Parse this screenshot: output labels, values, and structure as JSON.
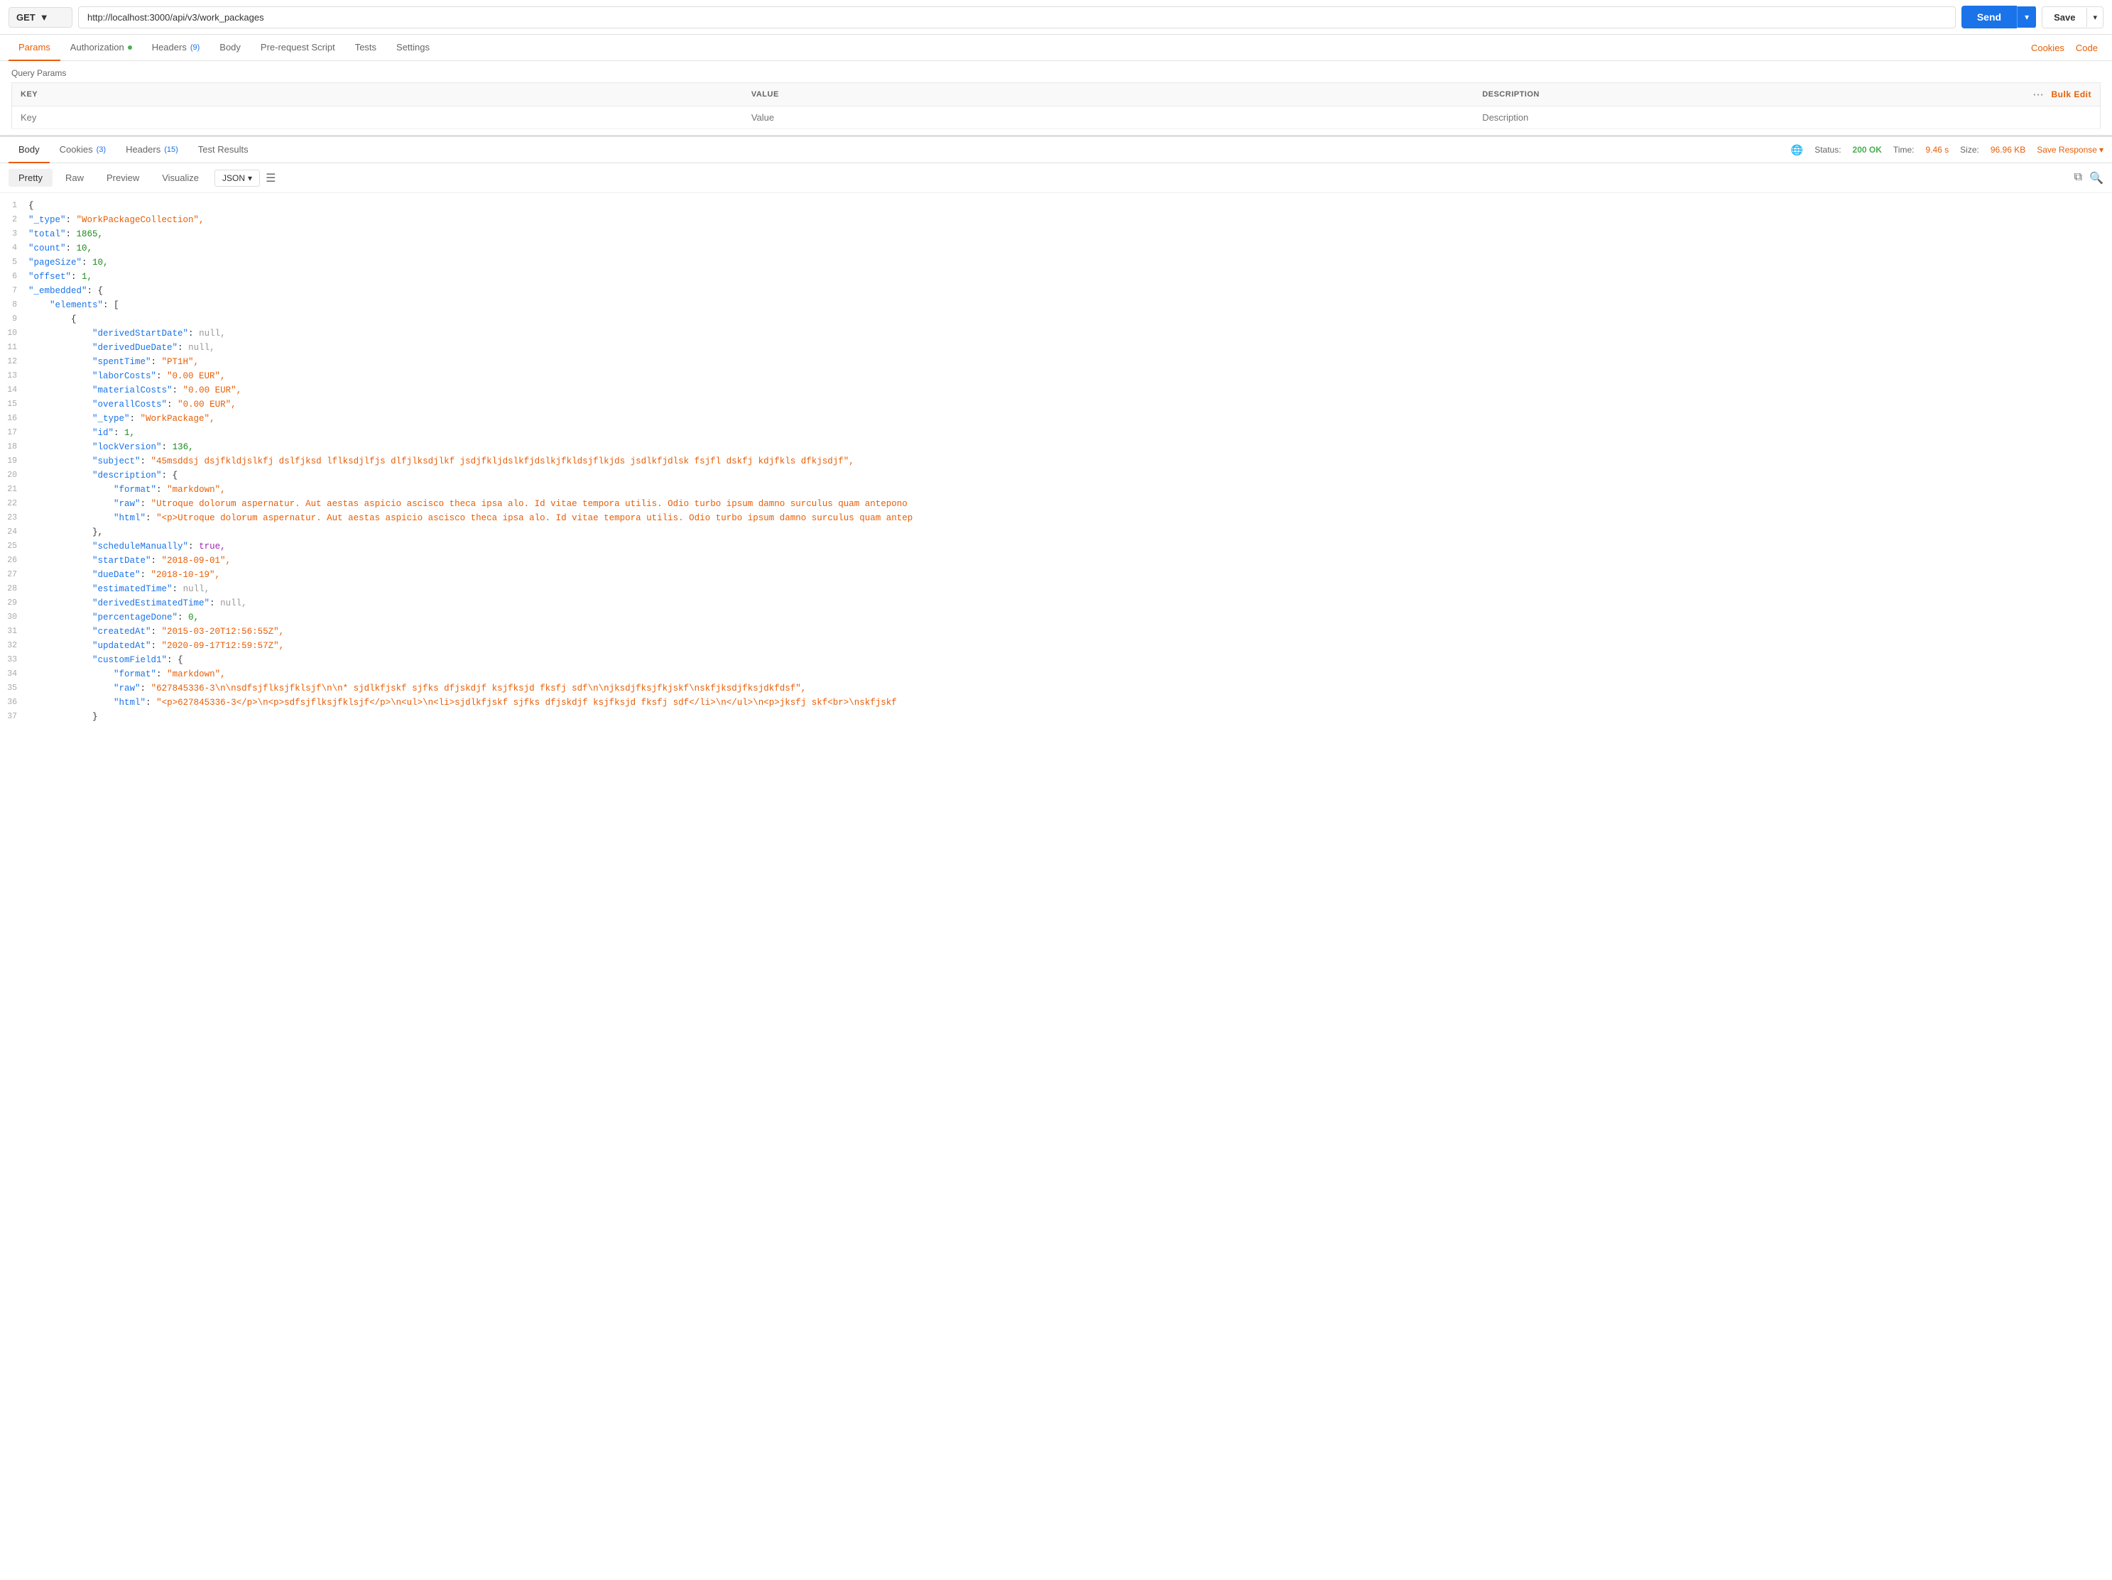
{
  "request_bar": {
    "method": "GET",
    "method_dropdown_icon": "▼",
    "url": "http://localhost:3000/api/v3/work_packages",
    "send_label": "Send",
    "send_dropdown_icon": "▾",
    "save_label": "Save",
    "save_dropdown_icon": "▾"
  },
  "request_tabs": [
    {
      "id": "params",
      "label": "Params",
      "active": true
    },
    {
      "id": "authorization",
      "label": "Authorization",
      "has_dot": true
    },
    {
      "id": "headers",
      "label": "Headers",
      "badge": "(9)"
    },
    {
      "id": "body",
      "label": "Body"
    },
    {
      "id": "prerequest",
      "label": "Pre-request Script"
    },
    {
      "id": "tests",
      "label": "Tests"
    },
    {
      "id": "settings",
      "label": "Settings"
    }
  ],
  "tab_links": [
    {
      "id": "cookies",
      "label": "Cookies"
    },
    {
      "id": "code",
      "label": "Code"
    }
  ],
  "query_params": {
    "title": "Query Params",
    "columns": [
      "KEY",
      "VALUE",
      "DESCRIPTION"
    ],
    "placeholder_row": {
      "key": "Key",
      "value": "Value",
      "description": "Description"
    }
  },
  "response": {
    "tabs": [
      {
        "id": "body",
        "label": "Body",
        "active": true
      },
      {
        "id": "cookies",
        "label": "Cookies",
        "badge": "(3)"
      },
      {
        "id": "headers",
        "label": "Headers",
        "badge": "(15)"
      },
      {
        "id": "test_results",
        "label": "Test Results"
      }
    ],
    "status_label": "Status:",
    "status_value": "200 OK",
    "time_label": "Time:",
    "time_value": "9.46 s",
    "size_label": "Size:",
    "size_value": "96.96 KB",
    "save_response_label": "Save Response",
    "save_response_icon": "▾"
  },
  "body_controls": {
    "view_tabs": [
      {
        "id": "pretty",
        "label": "Pretty",
        "active": true
      },
      {
        "id": "raw",
        "label": "Raw"
      },
      {
        "id": "preview",
        "label": "Preview"
      },
      {
        "id": "visualize",
        "label": "Visualize"
      }
    ],
    "format": "JSON",
    "format_icon": "▾"
  },
  "code_lines": [
    {
      "num": 1,
      "content": "{",
      "type": "plain"
    },
    {
      "num": 2,
      "content": "\"_type\": \"WorkPackageCollection\",",
      "key": "_type",
      "value": "WorkPackageCollection"
    },
    {
      "num": 3,
      "content": "\"total\": 1865,",
      "key": "total",
      "value": "1865"
    },
    {
      "num": 4,
      "content": "\"count\": 10,",
      "key": "count",
      "value": "10"
    },
    {
      "num": 5,
      "content": "\"pageSize\": 10,",
      "key": "pageSize",
      "value": "10"
    },
    {
      "num": 6,
      "content": "\"offset\": 1,",
      "key": "offset",
      "value": "1"
    },
    {
      "num": 7,
      "content": "\"_embedded\": {",
      "key": "_embedded"
    },
    {
      "num": 8,
      "content": "    \"elements\": [",
      "key": "elements"
    },
    {
      "num": 9,
      "content": "        {",
      "type": "plain"
    },
    {
      "num": 10,
      "content": "            \"derivedStartDate\": null,",
      "key": "derivedStartDate",
      "value": "null"
    },
    {
      "num": 11,
      "content": "            \"derivedDueDate\": null,",
      "key": "derivedDueDate",
      "value": "null"
    },
    {
      "num": 12,
      "content": "            \"spentTime\": \"PT1H\",",
      "key": "spentTime",
      "value": "PT1H"
    },
    {
      "num": 13,
      "content": "            \"laborCosts\": \"0.00 EUR\",",
      "key": "laborCosts",
      "value": "0.00 EUR"
    },
    {
      "num": 14,
      "content": "            \"materialCosts\": \"0.00 EUR\",",
      "key": "materialCosts",
      "value": "0.00 EUR"
    },
    {
      "num": 15,
      "content": "            \"overallCosts\": \"0.00 EUR\",",
      "key": "overallCosts",
      "value": "0.00 EUR"
    },
    {
      "num": 16,
      "content": "            \"_type\": \"WorkPackage\",",
      "key": "_type",
      "value": "WorkPackage"
    },
    {
      "num": 17,
      "content": "            \"id\": 1,",
      "key": "id",
      "value": "1"
    },
    {
      "num": 18,
      "content": "            \"lockVersion\": 136,",
      "key": "lockVersion",
      "value": "136"
    },
    {
      "num": 19,
      "content": "            \"subject\": \"45msddsj dsjfkldjslkfj dslfjksd lflksdjlfjs dlfjlksdjlkf jsdjfkljdslkfjdslkjfkldsjflkjds jsdlkfjdlsk fsjfl dskfj kdjfkls dfkjsdjf\",",
      "key": "subject",
      "value": "45msddsj dsjfkldjslkfj dslfjksd lflksdjlfjs dlfjlksdjlkf jsdjfkljdslkfjdslkjfkldsjflkjds jsdlkfjdlsk fsjfl dskfj kdjfkls dfkjsdjf"
    },
    {
      "num": 20,
      "content": "            \"description\": {",
      "key": "description"
    },
    {
      "num": 21,
      "content": "                \"format\": \"markdown\",",
      "key": "format",
      "value": "markdown"
    },
    {
      "num": 22,
      "content": "                \"raw\": \"Utroque dolorum aspernatur. Aut aestas aspicio ascisco theca ipsa alo. Id vitae tempora utilis. Odio turbo ipsum damno surculus quam antepono",
      "key": "raw",
      "value": "Utroque dolorum aspernatur. Aut aestas aspicio ascisco theca ipsa alo. Id vitae tempora utilis. Odio turbo ipsum damno surculus quam antepono"
    },
    {
      "num": 23,
      "content": "                \"html\": \"<p>Utroque dolorum aspernatur. Aut aestas aspicio ascisco theca ipsa alo. Id vitae tempora utilis. Odio turbo ipsum damno surculus quam antep",
      "key": "html",
      "value": "<p>Utroque dolorum aspernatur. Aut aestas aspicio ascisco theca ipsa alo. Id vitae tempora utilis. Odio turbo ipsum damno surculus quam antep"
    },
    {
      "num": 24,
      "content": "            },",
      "type": "plain"
    },
    {
      "num": 25,
      "content": "            \"scheduleManually\": true,",
      "key": "scheduleManually",
      "value": "true"
    },
    {
      "num": 26,
      "content": "            \"startDate\": \"2018-09-01\",",
      "key": "startDate",
      "value": "2018-09-01"
    },
    {
      "num": 27,
      "content": "            \"dueDate\": \"2018-10-19\",",
      "key": "dueDate",
      "value": "2018-10-19"
    },
    {
      "num": 28,
      "content": "            \"estimatedTime\": null,",
      "key": "estimatedTime",
      "value": "null"
    },
    {
      "num": 29,
      "content": "            \"derivedEstimatedTime\": null,",
      "key": "derivedEstimatedTime",
      "value": "null"
    },
    {
      "num": 30,
      "content": "            \"percentageDone\": 0,",
      "key": "percentageDone",
      "value": "0"
    },
    {
      "num": 31,
      "content": "            \"createdAt\": \"2015-03-20T12:56:55Z\",",
      "key": "createdAt",
      "value": "2015-03-20T12:56:55Z"
    },
    {
      "num": 32,
      "content": "            \"updatedAt\": \"2020-09-17T12:59:57Z\",",
      "key": "updatedAt",
      "value": "2020-09-17T12:59:57Z"
    },
    {
      "num": 33,
      "content": "            \"customField1\": {",
      "key": "customField1"
    },
    {
      "num": 34,
      "content": "                \"format\": \"markdown\",",
      "key": "format",
      "value": "markdown"
    },
    {
      "num": 35,
      "content": "                \"raw\": \"627845336-3\\n\\nsdfsjflksjfklsjf\\n\\n* sjdlkfjskf sjfks dfjskdjf ksjfksjd fksfj sdf\\n\\njksdjfksjfkjskf\\nskfjksdjfksjdkfdsf\",",
      "key": "raw",
      "value": "627845336-3\\n\\nsdfsjflksjfklsjf\\n\\n* sjdlkfjskf sjfks dfjskdjf ksjfksjd fksfj sdf\\n\\njksdjfksjfkjskf\\nskfjksdjfksjdkfdsf"
    },
    {
      "num": 36,
      "content": "                \"html\": \"<p>627845336-3</p>\\n<p>sdfsjflksjfklsjf</p>\\n<ul>\\n<li>sjdlkfjskf sjfks dfjskdjf ksjfksjd fksfj sdf</li>\\n</ul>\\n<p>jksfj skf<br>\\nskfjskf",
      "key": "html",
      "value": "<p>627845336-3</p>\\n<p>sdfsjflksjfklsjf</p>\\n<ul>\\n<li>sjdlkfjskf sjfks dfjskdjf ksjfksjd fksfj sdf</li>\\n</ul>\\n<p>jksfj skf<br>\\nskfjskf"
    },
    {
      "num": 37,
      "content": "            }",
      "type": "plain"
    }
  ]
}
